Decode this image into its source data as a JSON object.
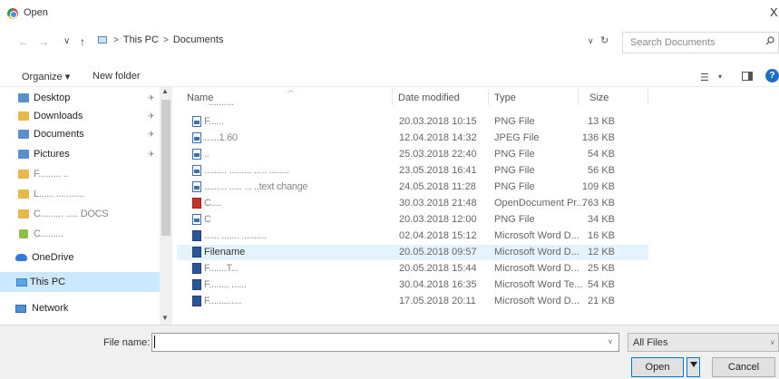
{
  "window": {
    "title": "Open",
    "close_glyph": "X"
  },
  "address": {
    "back": "←",
    "forward": "→",
    "up": "↑",
    "crumbs": [
      "This PC",
      "Documents"
    ],
    "dropdown": "∨",
    "refresh": "↻",
    "search_placeholder": "Search Documents"
  },
  "toolbar": {
    "organize": "Organize ▾",
    "new_folder": "New folder",
    "view_glyph": "☰",
    "view_dd": "▾",
    "help": "?"
  },
  "nav": {
    "items": [
      {
        "label": "Desktop",
        "icon": "folder-blue-icon",
        "pinned": true
      },
      {
        "label": "Downloads",
        "icon": "download-folder-icon",
        "pinned": true
      },
      {
        "label": "Documents",
        "icon": "documents-folder-icon",
        "pinned": true
      },
      {
        "label": "Pictures",
        "icon": "pictures-folder-icon",
        "pinned": true
      },
      {
        "label": "F......... ..",
        "icon": "folder-icon",
        "pinned": false
      },
      {
        "label": "L...... ...........",
        "icon": "folder-icon",
        "pinned": false
      },
      {
        "label": "C......... ..... DOCS",
        "icon": "folder-icon",
        "pinned": false
      },
      {
        "label": "C.........",
        "icon": "app-icon",
        "pinned": false
      },
      {
        "label": "OneDrive",
        "icon": "onedrive-icon",
        "pinned": false
      },
      {
        "label": "This PC",
        "icon": "this-pc-icon",
        "pinned": false
      },
      {
        "label": "Network",
        "icon": "network-icon",
        "pinned": false
      }
    ],
    "pin_glyph": "✈"
  },
  "columns": {
    "name": "Name",
    "date": "Date modified",
    "type": "Type",
    "size": "Size"
  },
  "files": [
    {
      "name": "..........",
      "date": "",
      "type": "",
      "size": "",
      "icon": "file-icon"
    },
    {
      "name": "F......",
      "date": "20.03.2018 10:15",
      "type": "PNG File",
      "size": "13 KB",
      "icon": "png-file-icon"
    },
    {
      "name": "......1.60",
      "date": "12.04.2018 14:32",
      "type": "JPEG File",
      "size": "136 KB",
      "icon": "png-file-icon"
    },
    {
      "name": "..",
      "date": "25.03.2018 22:40",
      "type": "PNG File",
      "size": "54 KB",
      "icon": "png-file-icon"
    },
    {
      "name": "......... ......... ..... ........",
      "date": "23.05.2018 16:41",
      "type": "PNG File",
      "size": "56 KB",
      "icon": "png-file-icon"
    },
    {
      "name": "......... ..... ... ..text change",
      "date": "24.05.2018 11:28",
      "type": "PNG File",
      "size": "109 KB",
      "icon": "png-file-icon"
    },
    {
      "name": "C....",
      "date": "30.03.2018 21:48",
      "type": "OpenDocument Pr...",
      "size": "763 KB",
      "icon": "odp-file-icon"
    },
    {
      "name": "C",
      "date": "20.03.2018 12:00",
      "type": "PNG File",
      "size": "34 KB",
      "icon": "png-file-icon"
    },
    {
      "name": "...... ....... ..........",
      "date": "02.04.2018 15:12",
      "type": "Microsoft Word D...",
      "size": "16 KB",
      "icon": "word-file-icon"
    },
    {
      "name": "Filename",
      "date": "20.05.2018 09:57",
      "type": "Microsoft Word D...",
      "size": "12 KB",
      "icon": "word-file-icon"
    },
    {
      "name": "F.......T...",
      "date": "20.05.2018 15:44",
      "type": "Microsoft Word D...",
      "size": "25 KB",
      "icon": "word-file-icon"
    },
    {
      "name": "F........ ......",
      "date": "30.04.2018 16:35",
      "type": "Microsoft Word Te...",
      "size": "54 KB",
      "icon": "word-file-icon"
    },
    {
      "name": "F.............",
      "date": "17.05.2018 20:11",
      "type": "Microsoft Word D...",
      "size": "21 KB",
      "icon": "word-file-icon"
    }
  ],
  "bottom": {
    "file_name_label": "File name:",
    "file_name_value": "",
    "dropdown": "∨",
    "filter": "All Files",
    "open": "Open",
    "cancel": "Cancel"
  }
}
